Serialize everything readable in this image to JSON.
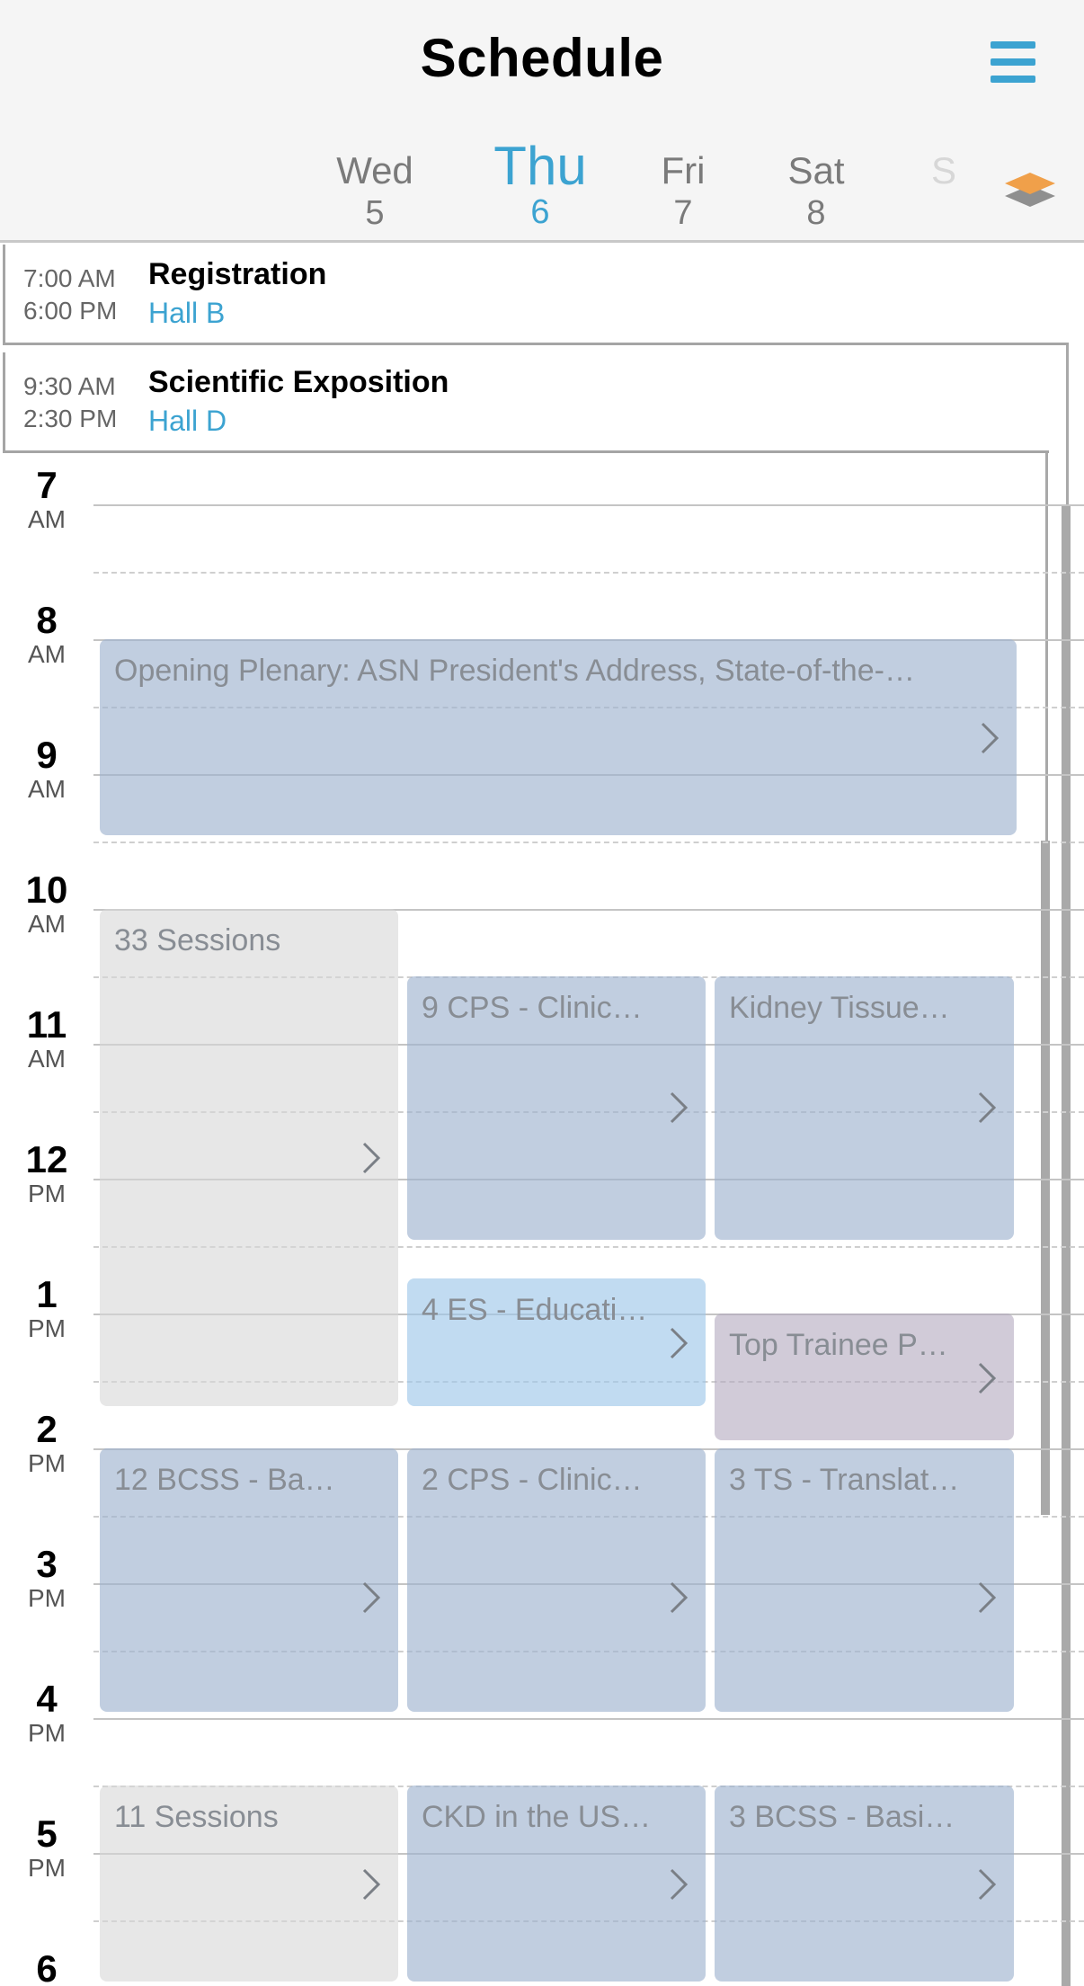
{
  "header": {
    "title": "Schedule",
    "days": [
      {
        "name": "Wed",
        "num": "5"
      },
      {
        "name": "Thu",
        "num": "6"
      },
      {
        "name": "Fri",
        "num": "7"
      },
      {
        "name": "Sat",
        "num": "8"
      },
      {
        "name": "S",
        "num": ""
      }
    ],
    "selected_day": "Thu",
    "icons": {
      "menu": "hamburger-menu-icon",
      "layers": "layers-icon"
    },
    "accent_color": "#3ca3d1"
  },
  "all_day_events": [
    {
      "start": "7:00 AM",
      "end": "6:00 PM",
      "title": "Registration",
      "location": "Hall B"
    },
    {
      "start": "9:30 AM",
      "end": "2:30 PM",
      "title": "Scientific Exposition",
      "location": "Hall D"
    }
  ],
  "hours": [
    {
      "num": "7",
      "ampm": "AM"
    },
    {
      "num": "8",
      "ampm": "AM"
    },
    {
      "num": "9",
      "ampm": "AM"
    },
    {
      "num": "10",
      "ampm": "AM"
    },
    {
      "num": "11",
      "ampm": "AM"
    },
    {
      "num": "12",
      "ampm": "PM"
    },
    {
      "num": "1",
      "ampm": "PM"
    },
    {
      "num": "2",
      "ampm": "PM"
    },
    {
      "num": "3",
      "ampm": "PM"
    },
    {
      "num": "4",
      "ampm": "PM"
    },
    {
      "num": "5",
      "ampm": "PM"
    },
    {
      "num": "6",
      "ampm": ""
    }
  ],
  "events": [
    {
      "title": "Opening Plenary: ASN President's Address, State-of-the-…"
    },
    {
      "title": "33 Sessions"
    },
    {
      "title": "9 CPS - Clinic…"
    },
    {
      "title": "Kidney Tissue…"
    },
    {
      "title": "4 ES - Educati…"
    },
    {
      "title": "Top Trainee P…"
    },
    {
      "title": "12 BCSS - Ba…"
    },
    {
      "title": "2 CPS - Clinic…"
    },
    {
      "title": "3 TS - Translat…"
    },
    {
      "title": "11 Sessions"
    },
    {
      "title": "CKD in the US…"
    },
    {
      "title": "3 BCSS - Basi…"
    }
  ]
}
